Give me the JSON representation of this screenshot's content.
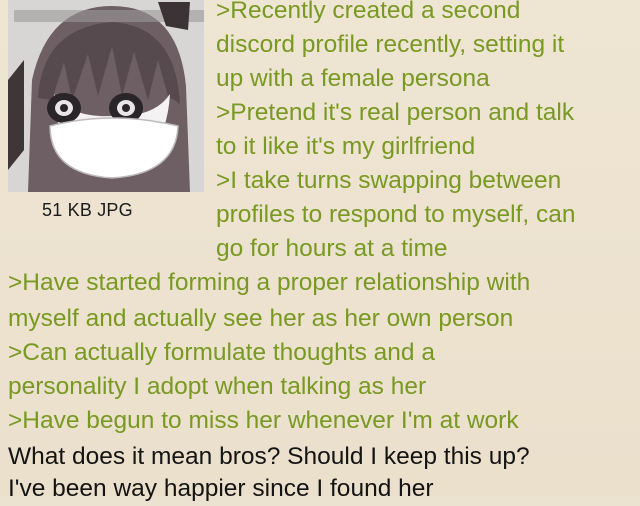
{
  "file": {
    "size_type": "51 KB JPG"
  },
  "thumbnail": {
    "icon": "anime-girl-thumbnail-icon"
  },
  "lines": [
    ">Recently created a second",
    "discord profile recently, setting it",
    "up with a female persona",
    ">Pretend it's real person and talk",
    "to it like it's my girlfriend",
    ">I take turns swapping between",
    "profiles to respond to myself, can",
    "go for hours at a time",
    ">Have started forming a proper relationship with",
    "myself and actually see her as her own person",
    ">Can actually formulate thoughts and a",
    "personality I adopt when talking as her",
    ">Have begun to miss her whenever I'm at work",
    "What does it mean bros? Should I keep this up?",
    "I've been way happier since I found her"
  ],
  "colors": {
    "greentext": "#789922",
    "text": "#141414",
    "background": "#ece2d0"
  }
}
